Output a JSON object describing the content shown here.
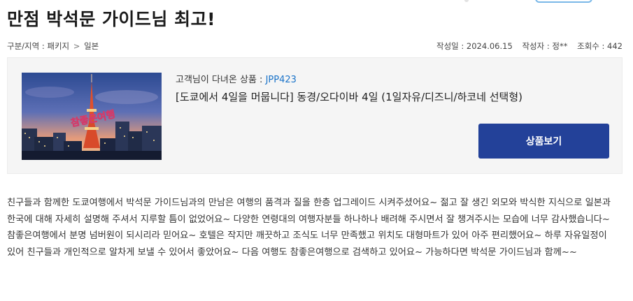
{
  "page": {
    "title": "만점 박석문 가이드님 최고!"
  },
  "breadcrumb": {
    "label": "구분/지역 : 패키지",
    "separator": ">",
    "region": "일본"
  },
  "meta": {
    "date_label": "작성일 : 2024.06.15",
    "author_label": "작성자 : 정**",
    "views_label": "조회수 : 442"
  },
  "product": {
    "code_prefix": "고객님이 다녀온 상품 : ",
    "code": "JPP423",
    "name": "[도쿄에서 4일을 머뭅니다] 동경/오다이바 4일 (1일자유/디즈니/하코네 선택형)",
    "image": {
      "subject": "tokyo-tower-night-photo",
      "watermark": "참좋은여행"
    },
    "view_button_label": "상품보기"
  },
  "review": {
    "body": "친구들과 함께한 도쿄여행에서 박석문 가이드님과의 만남은 여행의 품격과 질을 한층 업그레이드 시켜주셨어요~ 젊고 잘 생긴 외모와 박식한 지식으로 일본과 한국에 대해 자세히 설명해 주셔서 지루할 틈이 없었어요~ 다양한 연령대의 여행자분들 하나하나 배려해 주시면서 잘 챙겨주시는 모습에 너무 감사했습니다~ 참좋은여행에서 분명 넘버원이 되시리라 믿어요~ 호텔은 작지만 깨끗하고 조식도 너무 만족했고 위치도 대형마트가 있어 아주 편리했어요~ 하루 자유일정이 있어 친구들과 개인적으로 알차게 보낼 수 있어서 좋았어요~  다음 여행도 참좋은여행으로 검색하고 있어요~ 가능하다면 박석문 가이드님과 함께~~"
  },
  "colors": {
    "accent": "#234199",
    "code_blue": "#1a73c9",
    "box_bg": "#f5f5f5"
  }
}
